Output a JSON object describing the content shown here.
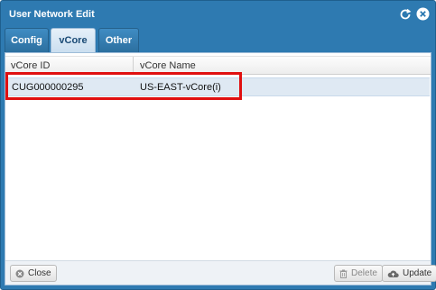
{
  "window": {
    "title": "User Network Edit",
    "icons": [
      "refresh-icon",
      "close-icon"
    ]
  },
  "tabs": [
    {
      "label": "Config",
      "active": false
    },
    {
      "label": "vCore",
      "active": true
    },
    {
      "label": "Other",
      "active": false
    }
  ],
  "grid": {
    "columns": [
      "vCore ID",
      "vCore Name"
    ],
    "rows": [
      {
        "vcore_id": "CUG000000295",
        "vcore_name": "US-EAST-vCore(i)",
        "selected": true
      }
    ]
  },
  "footer": {
    "close_label": "Close",
    "delete_label": "Delete",
    "update_label": "Update"
  },
  "colors": {
    "titlebar": "#2e7ab1",
    "highlight": "#e01010",
    "selected_row": "#dfe9f3"
  }
}
